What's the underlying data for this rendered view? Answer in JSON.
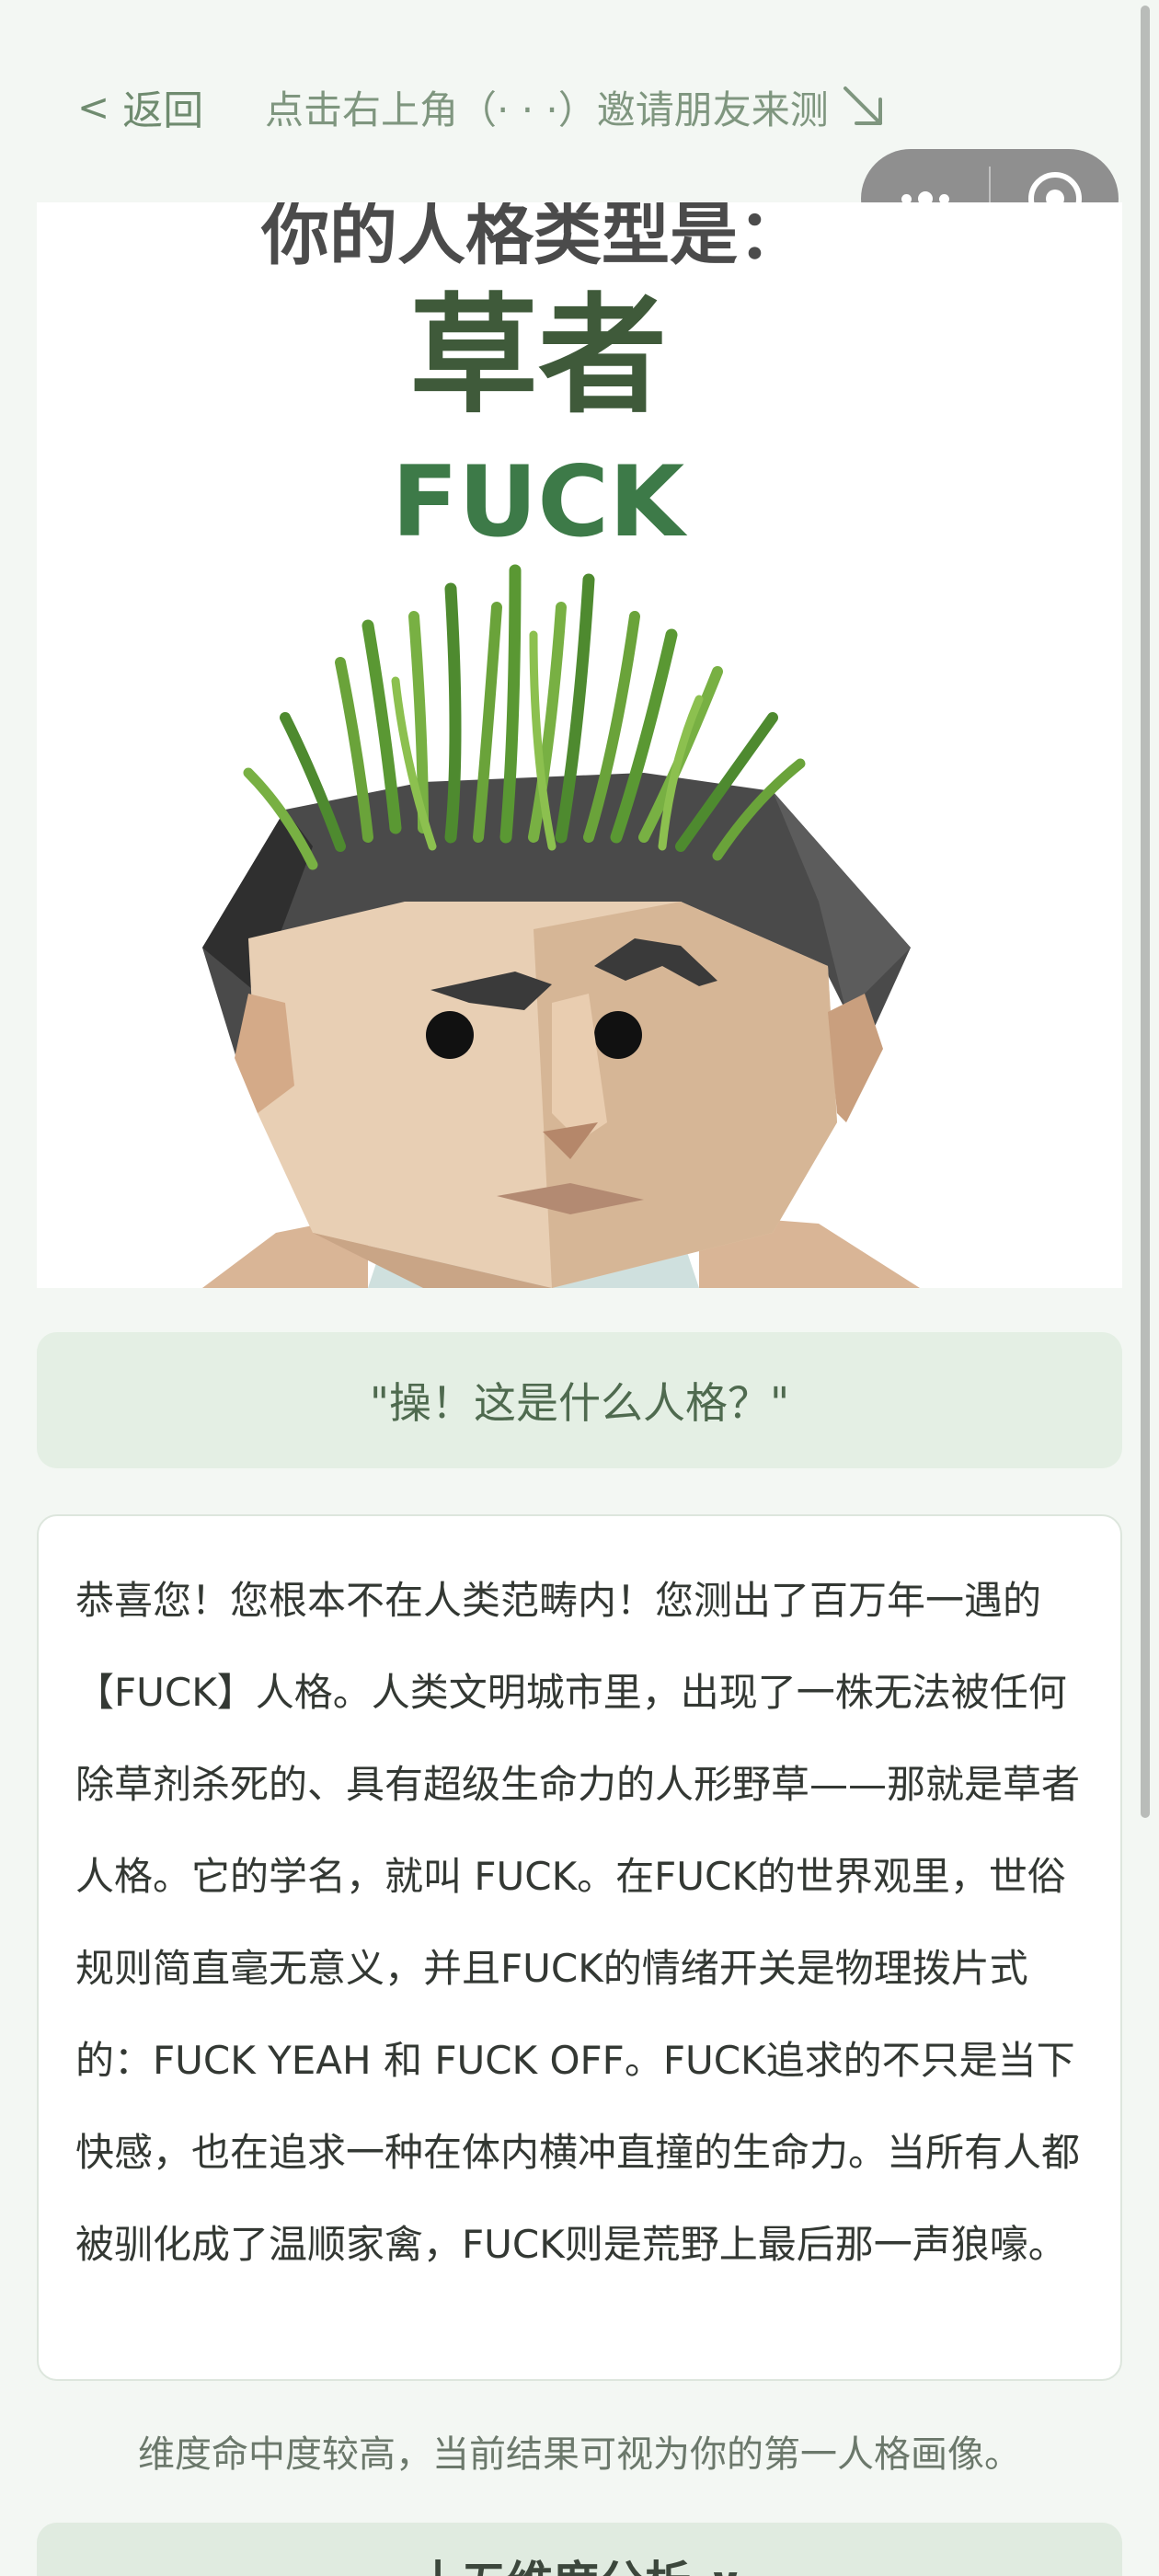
{
  "nav": {
    "back_arrow": "<",
    "back_label": "返回",
    "invite_text": "点击右上角（· · ·）邀请朋友来测",
    "invite_icon": "arrow-down-right-icon"
  },
  "capsule": {
    "more_icon": "more-dots-icon",
    "close_icon": "target-close-icon"
  },
  "hero": {
    "heading": "你的人格类型是：",
    "type_cn": "草者",
    "type_en": "FUCK"
  },
  "quote": "\"操！这是什么人格？\"",
  "description": "恭喜您！您根本不在人类范畴内！您测出了百万年一遇的【FUCK】人格。人类文明城市里，出现了一株无法被任何除草剂杀死的、具有超级生命力的人形野草——那就是草者人格。它的学名，就叫 FUCK。在FUCK的世界观里，世俗规则简直毫无意义，并且FUCK的情绪开关是物理拨片式的：FUCK YEAH 和 FUCK OFF。FUCK追求的不只是当下快感，也在追求一种在体内横冲直撞的生命力。当所有人都被驯化成了温顺家禽，FUCK则是荒野上最后那一声狼嚎。",
  "hint": "维度命中度较高，当前结果可视为你的第一人格画像。",
  "section_title": "十五维度分析 ∨",
  "colors": {
    "background": "#f3f7f3",
    "accent_green": "#3d7a48",
    "quote_bg": "#e4efe4"
  }
}
